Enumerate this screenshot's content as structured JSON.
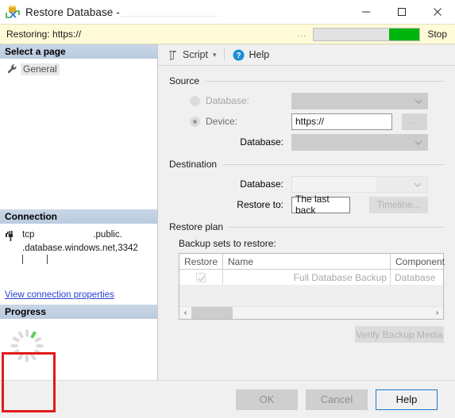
{
  "window": {
    "title": "Restore Database -",
    "icon": "restore-database-icon",
    "minimize_label": "Minimize",
    "maximize_label": "Maximize",
    "close_label": "Close"
  },
  "banner": {
    "status_text": "Restoring: https://",
    "ellipsis": "...",
    "progress_percent": 28,
    "progress_color": "#00b50d",
    "stop_label": "Stop",
    "background_color": "#fffbd9"
  },
  "sidebar": {
    "select_page_header": "Select a page",
    "pages": [
      {
        "label": "General",
        "icon": "wrench-icon",
        "selected": true
      }
    ],
    "connection": {
      "header": "Connection",
      "icon": "connection-plug-icon",
      "line1_prefix": "tcp",
      "line1_suffix": ".public.",
      "line2": ".database.windows.net,3342",
      "link_label": "View connection properties"
    },
    "progress": {
      "header": "Progress",
      "spinner": "loading-spinner-icon",
      "highlight_color": "#e01b1b"
    }
  },
  "toolbar": {
    "script_label": "Script",
    "script_icon": "script-icon",
    "script_caret": "▾",
    "help_label": "Help",
    "help_icon": "help-question-icon"
  },
  "source": {
    "group_title": "Source",
    "database_radio_label": "Database:",
    "database_radio_checked": false,
    "database_combo_value": "",
    "device_radio_label": "Device:",
    "device_radio_checked": true,
    "device_value": "https://",
    "browse_label": "...",
    "source_database_label": "Database:",
    "source_database_value": ""
  },
  "destination": {
    "group_title": "Destination",
    "database_label": "Database:",
    "database_value": "",
    "restore_to_label": "Restore to:",
    "restore_to_value": "The last back",
    "timeline_label": "Timeline..."
  },
  "restore_plan": {
    "group_title": "Restore plan",
    "backup_sets_label": "Backup sets to restore:",
    "columns": [
      "Restore",
      "Name",
      "Component"
    ],
    "rows": [
      {
        "restore_checked": true,
        "name": "Full Database Backup",
        "component": "Database"
      }
    ],
    "scroll_left_arrow": "‹",
    "scroll_right_arrow": "›",
    "verify_label": "Verify Backup Media"
  },
  "footer": {
    "ok_label": "OK",
    "cancel_label": "Cancel",
    "help_label": "Help",
    "focus_color": "#1b78d6"
  }
}
